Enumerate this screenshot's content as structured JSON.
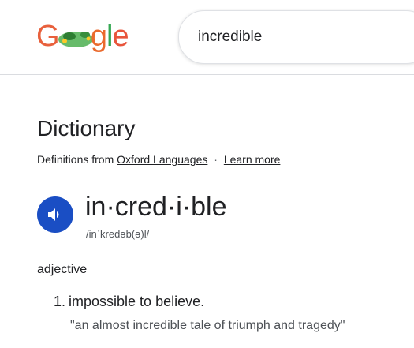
{
  "logo": {
    "letters": [
      "G",
      "o",
      "o",
      "g",
      "l",
      "e"
    ],
    "colors": [
      "#e8603c",
      "#d9a000",
      "#4caf50",
      "#ea6a2d",
      "#34a853",
      "#e8553c"
    ]
  },
  "search": {
    "query": "incredible"
  },
  "dictionary": {
    "title": "Dictionary",
    "definitions_from": "Definitions from",
    "source_link": "Oxford Languages",
    "separator": "·",
    "learn_more": "Learn more",
    "word": "in·cred·i·ble",
    "phonetic": "/inˈkredəb(ə)l/",
    "part_of_speech": "adjective",
    "definitions": [
      {
        "number": "1.",
        "text": "impossible to believe.",
        "example": "\"an almost incredible tale of triumph and tragedy\""
      }
    ]
  },
  "icons": {
    "speaker": "speaker-icon"
  },
  "colors": {
    "speaker_button": "#1a4ec4",
    "text": "#202124",
    "secondary_text": "#4d5156"
  }
}
